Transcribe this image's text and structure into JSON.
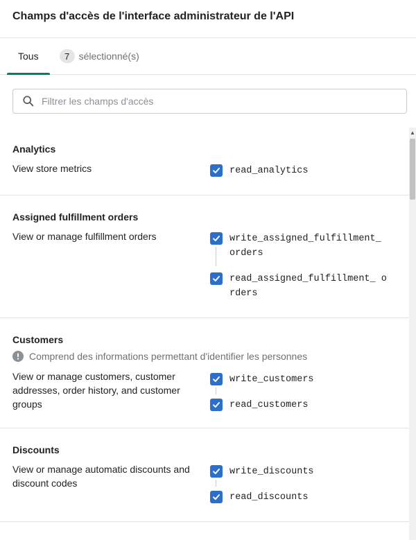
{
  "header": {
    "title": "Champs d'accès de l'interface administrateur de l'API"
  },
  "tabs": [
    {
      "label": "Tous"
    },
    {
      "count": "7",
      "label": "sélectionné(s)"
    }
  ],
  "search": {
    "placeholder": "Filtrer les champs d'accès",
    "value": ""
  },
  "colors": {
    "accent": "#008060",
    "checkbox": "#2c6ecb"
  },
  "sections": [
    {
      "title": "Analytics",
      "description": "View store metrics",
      "scopes": [
        {
          "label": "read_analytics",
          "checked": true
        }
      ]
    },
    {
      "title": "Assigned fulfillment orders",
      "description": "View or manage fulfillment orders",
      "scopes": [
        {
          "label": "write_assigned_fulfillment_ orders",
          "checked": true
        },
        {
          "label": "read_assigned_fulfillment_ orders",
          "checked": true
        }
      ]
    },
    {
      "title": "Customers",
      "note": "Comprend des informations permettant d'identifier les personnes",
      "description": "View or manage customers, customer addresses, order history, and customer groups",
      "scopes": [
        {
          "label": "write_customers",
          "checked": true
        },
        {
          "label": "read_customers",
          "checked": true
        }
      ]
    },
    {
      "title": "Discounts",
      "description": "View or manage automatic discounts and discount codes",
      "scopes": [
        {
          "label": "write_discounts",
          "checked": true
        },
        {
          "label": "read_discounts",
          "checked": true
        }
      ]
    }
  ]
}
